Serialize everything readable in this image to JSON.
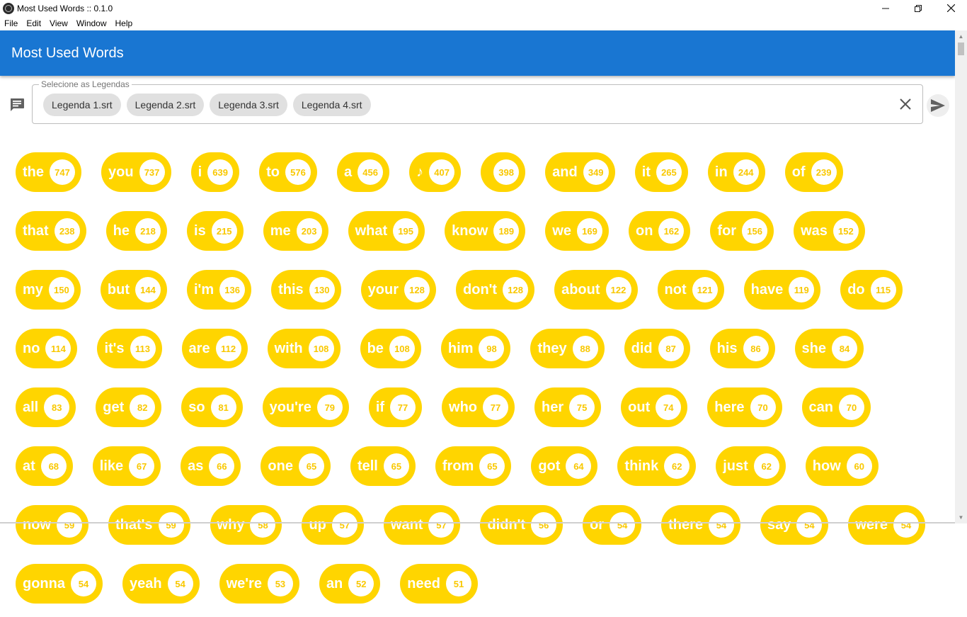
{
  "window": {
    "title": "Most Used Words :: 0.1.0",
    "controls": [
      "minimize-icon",
      "restore-icon",
      "close-icon"
    ]
  },
  "menu": [
    "File",
    "Edit",
    "View",
    "Window",
    "Help"
  ],
  "appbar": {
    "title": "Most Used Words",
    "color": "#1976d2"
  },
  "selector": {
    "label": "Selecione as Legendas",
    "files": [
      "Legenda 1.srt",
      "Legenda 2.srt",
      "Legenda 3.srt",
      "Legenda 4.srt"
    ],
    "icon": "message-icon",
    "clear_icon": "close-icon",
    "send_icon": "send-icon"
  },
  "word_chip_color": "#ffd500",
  "words": [
    {
      "word": "the",
      "count": "747"
    },
    {
      "word": "you",
      "count": "737"
    },
    {
      "word": "i",
      "count": "639"
    },
    {
      "word": "to",
      "count": "576"
    },
    {
      "word": "a",
      "count": "456"
    },
    {
      "word": "♪",
      "count": "407"
    },
    {
      "word": "",
      "count": "398"
    },
    {
      "word": "and",
      "count": "349"
    },
    {
      "word": "it",
      "count": "265"
    },
    {
      "word": "in",
      "count": "244"
    },
    {
      "word": "of",
      "count": "239"
    },
    {
      "word": "that",
      "count": "238"
    },
    {
      "word": "he",
      "count": "218"
    },
    {
      "word": "is",
      "count": "215"
    },
    {
      "word": "me",
      "count": "203"
    },
    {
      "word": "what",
      "count": "195"
    },
    {
      "word": "know",
      "count": "189"
    },
    {
      "word": "we",
      "count": "169"
    },
    {
      "word": "on",
      "count": "162"
    },
    {
      "word": "for",
      "count": "156"
    },
    {
      "word": "was",
      "count": "152"
    },
    {
      "word": "my",
      "count": "150"
    },
    {
      "word": "but",
      "count": "144"
    },
    {
      "word": "i'm",
      "count": "136"
    },
    {
      "word": "this",
      "count": "130"
    },
    {
      "word": "your",
      "count": "128"
    },
    {
      "word": "don't",
      "count": "128"
    },
    {
      "word": "about",
      "count": "122"
    },
    {
      "word": "not",
      "count": "121"
    },
    {
      "word": "have",
      "count": "119"
    },
    {
      "word": "do",
      "count": "115"
    },
    {
      "word": "no",
      "count": "114"
    },
    {
      "word": "it's",
      "count": "113"
    },
    {
      "word": "are",
      "count": "112"
    },
    {
      "word": "with",
      "count": "108"
    },
    {
      "word": "be",
      "count": "108"
    },
    {
      "word": "him",
      "count": "98"
    },
    {
      "word": "they",
      "count": "88"
    },
    {
      "word": "did",
      "count": "87"
    },
    {
      "word": "his",
      "count": "86"
    },
    {
      "word": "she",
      "count": "84"
    },
    {
      "word": "all",
      "count": "83"
    },
    {
      "word": "get",
      "count": "82"
    },
    {
      "word": "so",
      "count": "81"
    },
    {
      "word": "you're",
      "count": "79"
    },
    {
      "word": "if",
      "count": "77"
    },
    {
      "word": "who",
      "count": "77"
    },
    {
      "word": "her",
      "count": "75"
    },
    {
      "word": "out",
      "count": "74"
    },
    {
      "word": "here",
      "count": "70"
    },
    {
      "word": "can",
      "count": "70"
    },
    {
      "word": "at",
      "count": "68"
    },
    {
      "word": "like",
      "count": "67"
    },
    {
      "word": "as",
      "count": "66"
    },
    {
      "word": "one",
      "count": "65"
    },
    {
      "word": "tell",
      "count": "65"
    },
    {
      "word": "from",
      "count": "65"
    },
    {
      "word": "got",
      "count": "64"
    },
    {
      "word": "think",
      "count": "62"
    },
    {
      "word": "just",
      "count": "62"
    },
    {
      "word": "how",
      "count": "60"
    },
    {
      "word": "now",
      "count": "59"
    },
    {
      "word": "that's",
      "count": "59"
    },
    {
      "word": "why",
      "count": "58"
    },
    {
      "word": "up",
      "count": "57"
    },
    {
      "word": "want",
      "count": "57"
    },
    {
      "word": "didn't",
      "count": "56"
    },
    {
      "word": "or",
      "count": "54"
    },
    {
      "word": "there",
      "count": "54"
    },
    {
      "word": "say",
      "count": "54"
    },
    {
      "word": "were",
      "count": "54"
    },
    {
      "word": "gonna",
      "count": "54"
    },
    {
      "word": "yeah",
      "count": "54"
    },
    {
      "word": "we're",
      "count": "53"
    },
    {
      "word": "an",
      "count": "52"
    },
    {
      "word": "need",
      "count": "51"
    }
  ]
}
